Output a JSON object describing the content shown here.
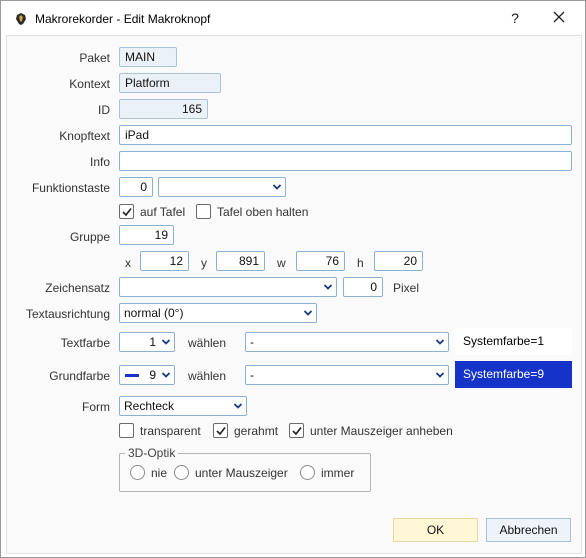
{
  "window": {
    "title": "Makrorekorder - Edit Makroknopf",
    "help_label": "?"
  },
  "labels": {
    "paket": "Paket",
    "kontext": "Kontext",
    "id": "ID",
    "knopftext": "Knopftext",
    "info": "Info",
    "funktionstaste": "Funktionstaste",
    "gruppe": "Gruppe",
    "x": "x",
    "y": "y",
    "w": "w",
    "h": "h",
    "zeichensatz": "Zeichensatz",
    "pixel": "Pixel",
    "textausrichtung": "Textausrichtung",
    "textfarbe": "Textfarbe",
    "grundfarbe": "Grundfarbe",
    "waehlen": "wählen",
    "form": "Form"
  },
  "fields": {
    "paket": "MAIN",
    "kontext": "Platform",
    "id": "165",
    "knopftext": "iPad",
    "info": "",
    "funktionstaste_num": "0",
    "funktionstaste_key": "",
    "gruppe": "19",
    "x": "12",
    "y": "891",
    "w": "76",
    "h": "20",
    "zeichensatz": "",
    "pixel": "0",
    "textausrichtung": "normal (0°)",
    "textfarbe_num": "1",
    "textfarbe_choice": "-",
    "grundfarbe_num": "9",
    "grundfarbe_choice": "-",
    "form": "Rechteck"
  },
  "checkboxes": {
    "auf_tafel": {
      "label": "auf Tafel",
      "checked": true
    },
    "tafel_oben_halten": {
      "label": "Tafel oben halten",
      "checked": false
    },
    "transparent": {
      "label": "transparent",
      "checked": false
    },
    "gerahmt": {
      "label": "gerahmt",
      "checked": true
    },
    "unter_mauszeiger_anheben": {
      "label": "unter Mauszeiger anheben",
      "checked": true
    }
  },
  "color_boxes": {
    "textfarbe": "Systemfarbe=1",
    "grundfarbe": "Systemfarbe=9"
  },
  "optik": {
    "legend": "3D-Optik",
    "options": [
      "nie",
      "unter Mauszeiger",
      "immer"
    ]
  },
  "buttons": {
    "ok": "OK",
    "cancel": "Abbrechen"
  },
  "colors": {
    "accent_blue": "#1533c8",
    "field_border": "#8ab0d3",
    "ok_bg": "#fff7d6"
  }
}
